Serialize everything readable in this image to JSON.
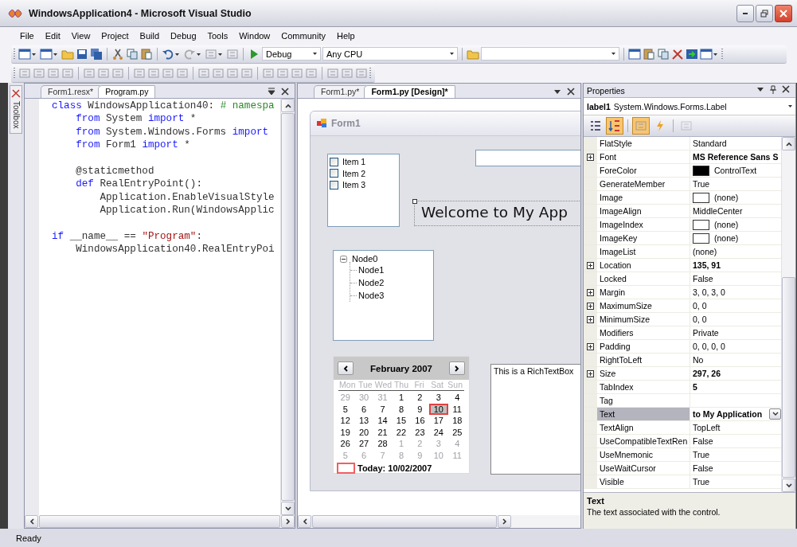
{
  "window": {
    "title": "WindowsApplication4 - Microsoft Visual Studio"
  },
  "menu": [
    "File",
    "Edit",
    "View",
    "Project",
    "Build",
    "Debug",
    "Tools",
    "Window",
    "Community",
    "Help"
  ],
  "toolbar": {
    "configuration": "Debug",
    "platform": "Any CPU"
  },
  "toolbox": {
    "label": "Toolbox"
  },
  "code_editor": {
    "tabs": [
      {
        "label": "Form1.resx*",
        "selected": false
      },
      {
        "label": "Program.py",
        "selected": true
      }
    ],
    "lines": [
      {
        "gap_before": false,
        "segments": [
          {
            "kind": "keyword",
            "text": "class"
          },
          {
            "kind": "plain",
            "text": " WindowsApplication40: "
          },
          {
            "kind": "comment",
            "text": "# namespa"
          }
        ]
      },
      {
        "gap_before": false,
        "segments": [
          {
            "kind": "keyword",
            "text": "    from"
          },
          {
            "kind": "plain",
            "text": " System "
          },
          {
            "kind": "keyword",
            "text": "import"
          },
          {
            "kind": "plain",
            "text": " *"
          }
        ]
      },
      {
        "gap_before": false,
        "segments": [
          {
            "kind": "keyword",
            "text": "    from"
          },
          {
            "kind": "plain",
            "text": " System.Windows.Forms "
          },
          {
            "kind": "keyword",
            "text": "import"
          }
        ]
      },
      {
        "gap_before": false,
        "segments": [
          {
            "kind": "keyword",
            "text": "    from"
          },
          {
            "kind": "plain",
            "text": " Form1 "
          },
          {
            "kind": "keyword",
            "text": "import"
          },
          {
            "kind": "plain",
            "text": " *"
          }
        ]
      },
      {
        "gap_before": true,
        "segments": [
          {
            "kind": "plain",
            "text": "    @staticmethod"
          }
        ]
      },
      {
        "gap_before": false,
        "segments": [
          {
            "kind": "keyword",
            "text": "    def"
          },
          {
            "kind": "plain",
            "text": " RealEntryPoint():"
          }
        ]
      },
      {
        "gap_before": false,
        "segments": [
          {
            "kind": "plain",
            "text": "        Application.EnableVisualStyle"
          }
        ]
      },
      {
        "gap_before": false,
        "segments": [
          {
            "kind": "plain",
            "text": "        Application.Run(WindowsApplic"
          }
        ]
      },
      {
        "gap_before": true,
        "segments": [
          {
            "kind": "keyword",
            "text": "if"
          },
          {
            "kind": "plain",
            "text": " __name__ == "
          },
          {
            "kind": "string",
            "text": "\"Program\""
          },
          {
            "kind": "plain",
            "text": ":"
          }
        ]
      },
      {
        "gap_before": false,
        "segments": [
          {
            "kind": "plain",
            "text": "    WindowsApplication40.RealEntryPoi"
          }
        ]
      }
    ]
  },
  "designer": {
    "tabs": [
      {
        "label": "Form1.py*",
        "selected": false
      },
      {
        "label": "Form1.py [Design]*",
        "selected": true
      }
    ],
    "form": {
      "title": "Form1",
      "checked_list": [
        {
          "label": "Item 1",
          "checked": false
        },
        {
          "label": "Item 2",
          "checked": false
        },
        {
          "label": "Item 3",
          "checked": false
        }
      ],
      "label": "Welcome to My App",
      "tree": {
        "label": "Node0",
        "expanded": true,
        "children": [
          {
            "label": "Node1"
          },
          {
            "label": "Node2"
          },
          {
            "label": "Node3"
          }
        ]
      },
      "calendar": {
        "month": "February 2007",
        "weekdays": [
          "Mon",
          "Tue",
          "Wed",
          "Thu",
          "Fri",
          "Sat",
          "Sun"
        ],
        "weeks": [
          [
            {
              "day": "29",
              "other_month": true,
              "selected": false
            },
            {
              "day": "30",
              "other_month": true,
              "selected": false
            },
            {
              "day": "31",
              "other_month": true,
              "selected": false
            },
            {
              "day": "1",
              "other_month": false,
              "selected": false
            },
            {
              "day": "2",
              "other_month": false,
              "selected": false
            },
            {
              "day": "3",
              "other_month": false,
              "selected": false
            },
            {
              "day": "4",
              "other_month": false,
              "selected": false
            }
          ],
          [
            {
              "day": "5",
              "other_month": false,
              "selected": false
            },
            {
              "day": "6",
              "other_month": false,
              "selected": false
            },
            {
              "day": "7",
              "other_month": false,
              "selected": false
            },
            {
              "day": "8",
              "other_month": false,
              "selected": false
            },
            {
              "day": "9",
              "other_month": false,
              "selected": false
            },
            {
              "day": "10",
              "other_month": false,
              "selected": true
            },
            {
              "day": "11",
              "other_month": false,
              "selected": false
            }
          ],
          [
            {
              "day": "12",
              "other_month": false,
              "selected": false
            },
            {
              "day": "13",
              "other_month": false,
              "selected": false
            },
            {
              "day": "14",
              "other_month": false,
              "selected": false
            },
            {
              "day": "15",
              "other_month": false,
              "selected": false
            },
            {
              "day": "16",
              "other_month": false,
              "selected": false
            },
            {
              "day": "17",
              "other_month": false,
              "selected": false
            },
            {
              "day": "18",
              "other_month": false,
              "selected": false
            }
          ],
          [
            {
              "day": "19",
              "other_month": false,
              "selected": false
            },
            {
              "day": "20",
              "other_month": false,
              "selected": false
            },
            {
              "day": "21",
              "other_month": false,
              "selected": false
            },
            {
              "day": "22",
              "other_month": false,
              "selected": false
            },
            {
              "day": "23",
              "other_month": false,
              "selected": false
            },
            {
              "day": "24",
              "other_month": false,
              "selected": false
            },
            {
              "day": "25",
              "other_month": false,
              "selected": false
            }
          ],
          [
            {
              "day": "26",
              "other_month": false,
              "selected": false
            },
            {
              "day": "27",
              "other_month": false,
              "selected": false
            },
            {
              "day": "28",
              "other_month": false,
              "selected": false
            },
            {
              "day": "1",
              "other_month": true,
              "selected": false
            },
            {
              "day": "2",
              "other_month": true,
              "selected": false
            },
            {
              "day": "3",
              "other_month": true,
              "selected": false
            },
            {
              "day": "4",
              "other_month": true,
              "selected": false
            }
          ],
          [
            {
              "day": "5",
              "other_month": true,
              "selected": false
            },
            {
              "day": "6",
              "other_month": true,
              "selected": false
            },
            {
              "day": "7",
              "other_month": true,
              "selected": false
            },
            {
              "day": "8",
              "other_month": true,
              "selected": false
            },
            {
              "day": "9",
              "other_month": true,
              "selected": false
            },
            {
              "day": "10",
              "other_month": true,
              "selected": false
            },
            {
              "day": "11",
              "other_month": true,
              "selected": false
            }
          ]
        ],
        "today": "Today: 10/02/2007"
      },
      "rich_text": "This is a RichTextBox"
    }
  },
  "properties": {
    "title": "Properties",
    "object_name": "label1",
    "object_type": "System.Windows.Forms.Label",
    "rows": [
      {
        "name": "FlatStyle",
        "value": "Standard",
        "kind": "text",
        "expandable": false,
        "modified": false,
        "selected": false
      },
      {
        "name": "Font",
        "value": "MS Reference Sans S",
        "kind": "text",
        "expandable": true,
        "modified": true,
        "selected": false
      },
      {
        "name": "ForeColor",
        "value": "ControlText",
        "kind": "color",
        "color": "#000000",
        "expandable": false,
        "modified": false,
        "selected": false
      },
      {
        "name": "GenerateMember",
        "value": "True",
        "kind": "text",
        "expandable": false,
        "modified": false,
        "selected": false
      },
      {
        "name": "Image",
        "value": "(none)",
        "kind": "image",
        "expandable": false,
        "modified": false,
        "selected": false
      },
      {
        "name": "ImageAlign",
        "value": "MiddleCenter",
        "kind": "text",
        "expandable": false,
        "modified": false,
        "selected": false
      },
      {
        "name": "ImageIndex",
        "value": "(none)",
        "kind": "image",
        "expandable": false,
        "modified": false,
        "selected": false
      },
      {
        "name": "ImageKey",
        "value": "(none)",
        "kind": "image",
        "expandable": false,
        "modified": false,
        "selected": false
      },
      {
        "name": "ImageList",
        "value": "(none)",
        "kind": "text",
        "expandable": false,
        "modified": false,
        "selected": false
      },
      {
        "name": "Location",
        "value": "135, 91",
        "kind": "text",
        "expandable": true,
        "modified": true,
        "selected": false
      },
      {
        "name": "Locked",
        "value": "False",
        "kind": "text",
        "expandable": false,
        "modified": false,
        "selected": false
      },
      {
        "name": "Margin",
        "value": "3, 0, 3, 0",
        "kind": "text",
        "expandable": true,
        "modified": false,
        "selected": false
      },
      {
        "name": "MaximumSize",
        "value": "0, 0",
        "kind": "text",
        "expandable": true,
        "modified": false,
        "selected": false
      },
      {
        "name": "MinimumSize",
        "value": "0, 0",
        "kind": "text",
        "expandable": true,
        "modified": false,
        "selected": false
      },
      {
        "name": "Modifiers",
        "value": "Private",
        "kind": "text",
        "expandable": false,
        "modified": false,
        "selected": false
      },
      {
        "name": "Padding",
        "value": "0, 0, 0, 0",
        "kind": "text",
        "expandable": true,
        "modified": false,
        "selected": false
      },
      {
        "name": "RightToLeft",
        "value": "No",
        "kind": "text",
        "expandable": false,
        "modified": false,
        "selected": false
      },
      {
        "name": "Size",
        "value": "297, 26",
        "kind": "text",
        "expandable": true,
        "modified": true,
        "selected": false
      },
      {
        "name": "TabIndex",
        "value": "5",
        "kind": "text",
        "expandable": false,
        "modified": true,
        "selected": false
      },
      {
        "name": "Tag",
        "kind": "text",
        "expandable": false,
        "selected": false
      },
      {
        "name": "Text",
        "value": "to My Application",
        "kind": "editing",
        "expandable": false,
        "modified": true,
        "selected": true
      },
      {
        "name": "TextAlign",
        "value": "TopLeft",
        "kind": "text",
        "expandable": false,
        "modified": false,
        "selected": false
      },
      {
        "name": "UseCompatibleTextRen",
        "value": "False",
        "kind": "text",
        "expandable": false,
        "modified": false,
        "selected": false
      },
      {
        "name": "UseMnemonic",
        "value": "True",
        "kind": "text",
        "expandable": false,
        "modified": false,
        "selected": false
      },
      {
        "name": "UseWaitCursor",
        "value": "False",
        "kind": "text",
        "expandable": false,
        "modified": false,
        "selected": false
      },
      {
        "name": "Visible",
        "value": "True",
        "kind": "text",
        "expandable": false,
        "modified": false,
        "selected": false
      }
    ],
    "description": {
      "title": "Text",
      "text": "The text associated with the control."
    }
  },
  "status_bar": {
    "text": "Ready"
  }
}
